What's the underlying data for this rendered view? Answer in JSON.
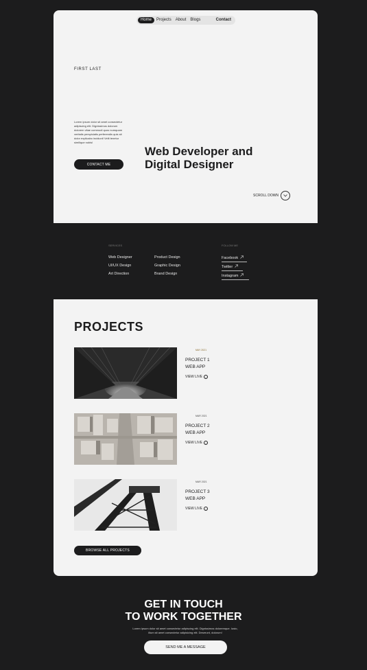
{
  "nav": {
    "items": [
      {
        "label": "Home"
      },
      {
        "label": "Projects"
      },
      {
        "label": "About"
      },
      {
        "label": "Blogs"
      }
    ],
    "contact_label": "Contact"
  },
  "hero": {
    "brand": "FIRST LAST",
    "bio": "Lorem ipsum dolor sit amet consectetur adipiscing elit. Dignissimos dolorum dolorem vitae commodi quos numquam veritatis perspiciatis perferendis quis sit dolor explicabo incidunt! Velit tenetur similique nobis!",
    "contact_button": "CONTACT ME",
    "headline_1": "Web Developer and",
    "headline_2": "Digital Designer",
    "scroll_label": "SCROLL DOWN"
  },
  "services": {
    "heading": "SERVICES",
    "col1": [
      "Web Designer",
      "UI/UX Design",
      "Art Direction"
    ],
    "col2": [
      "Product Design",
      "Graphic Design",
      "Brand Design"
    ],
    "follow_heading": "FOLLOW ME",
    "social": [
      {
        "label": "Facebook"
      },
      {
        "label": "Twitter"
      },
      {
        "label": "Instagram"
      }
    ]
  },
  "projects": {
    "title": "PROJECTS",
    "items": [
      {
        "date": "MAY 2021",
        "title_1": "PROJECT 1",
        "title_2": "WEB APP",
        "live": "VIEW LIVE"
      },
      {
        "date": "MAR 2021",
        "title_1": "PROJECT 2",
        "title_2": "WEB APP",
        "live": "VIEW LIVE"
      },
      {
        "date": "MAR 2021",
        "title_1": "PROJECT 3",
        "title_2": "WEB APP",
        "live": "VIEW LIVE"
      }
    ],
    "browse_button": "BROWSE ALL PROJECTS"
  },
  "contact": {
    "title_1": "GET IN TOUCH",
    "title_2": "TO WORK TOGETHER",
    "text": "Lorem ipsum dolor sit amet consectetur adipiscing elit. Dignissimos doloremque. Iusto, illum sit amet consectetur adipisicing elit. Deserunt, dolorum!",
    "button": "SEND ME A MESSAGE"
  }
}
